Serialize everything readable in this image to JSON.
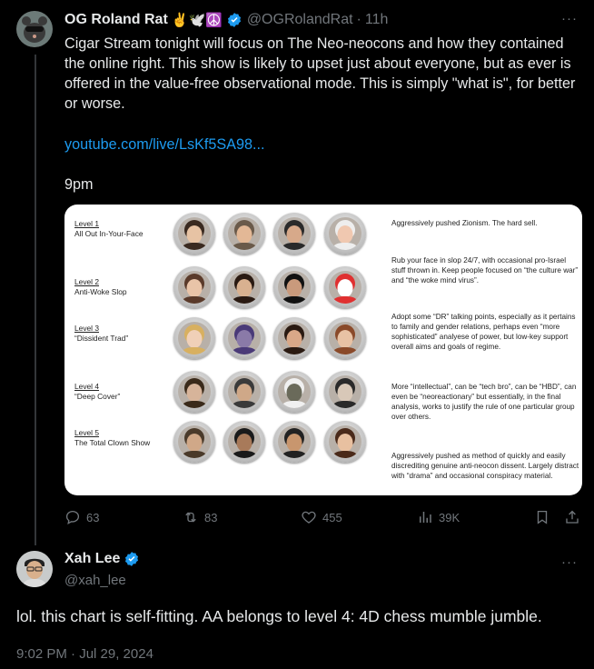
{
  "tweet": {
    "name": "OG Roland Rat",
    "emojis": "✌️🕊️☮️",
    "handle": "@OGRolandRat",
    "time": "11h",
    "text": "Cigar Stream tonight will focus on The Neo-neocons and how they contained the online right. This show is likely to upset just about everyone, but as ever is offered in the value-free observational mode. This is simply \"what is\", for better or worse.",
    "link": "youtube.com/live/LsKf5SA98...",
    "time_line": "9pm",
    "more_label": "···",
    "replies": "63",
    "reposts": "83",
    "likes": "455",
    "views": "39K"
  },
  "chart": {
    "levels": [
      {
        "num": "Level 1",
        "name": "All Out In-Your-Face",
        "desc": "Aggressively pushed Zionism. The hard sell."
      },
      {
        "num": "Level 2",
        "name": "Anti-Woke Slop",
        "desc": "Rub your face in slop 24/7, with occasional pro-Israel stuff thrown in. Keep people focused on “the culture war” and “the woke mind virus”."
      },
      {
        "num": "Level 3",
        "name": "“Dissident Trad”",
        "desc": "Adopt some “DR” talking points, especially as it pertains to family and gender relations, perhaps even “more sophisticated” analyese of power, but low-key support overall aims and goals of regime."
      },
      {
        "num": "Level 4",
        "name": "“Deep Cover”",
        "desc": "More “intellectual”, can be “tech bro”, can be “HBD”, can even be “neoreactionary” but essentially, in the final analysis, works to justify the rule of one particular group over others."
      },
      {
        "num": "Level 5",
        "name": "The Total Clown Show",
        "desc": "Aggressively pushed as method of quickly and easily discrediting genuine anti-neocon dissent. Largely distract with “drama” and occasional conspiracy material."
      }
    ]
  },
  "reply": {
    "name": "Xah Lee",
    "handle": "@xah_lee",
    "text": "lol. this chart is self-fitting. AA belongs to level 4: 4D chess mumble jumble.",
    "timestamp": "9:02 PM · Jul 29, 2024",
    "more_label": "···"
  },
  "colors": {
    "accent": "#1d9bf0",
    "muted": "#71767b",
    "text": "#e7e9ea",
    "bg": "#000000"
  }
}
